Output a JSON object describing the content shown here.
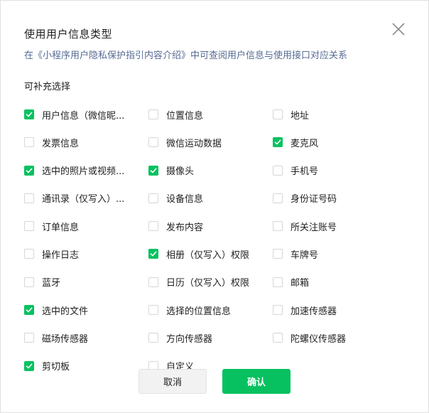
{
  "dialog": {
    "title": "使用用户信息类型",
    "sub_prefix": "在",
    "sub_link": "《小程序用户隐私保护指引内容介绍》",
    "sub_suffix": "中可查阅用户信息与使用接口对应关系",
    "section_label": "可补充选择"
  },
  "options": [
    {
      "label": "用户信息（微信昵...",
      "checked": true
    },
    {
      "label": "位置信息",
      "checked": false
    },
    {
      "label": "地址",
      "checked": false
    },
    {
      "label": "发票信息",
      "checked": false
    },
    {
      "label": "微信运动数据",
      "checked": false
    },
    {
      "label": "麦克风",
      "checked": true
    },
    {
      "label": "选中的照片或视频...",
      "checked": true
    },
    {
      "label": "摄像头",
      "checked": true
    },
    {
      "label": "手机号",
      "checked": false
    },
    {
      "label": "通讯录（仅写入）...",
      "checked": false
    },
    {
      "label": "设备信息",
      "checked": false
    },
    {
      "label": "身份证号码",
      "checked": false
    },
    {
      "label": "订单信息",
      "checked": false
    },
    {
      "label": "发布内容",
      "checked": false
    },
    {
      "label": "所关注账号",
      "checked": false
    },
    {
      "label": "操作日志",
      "checked": false
    },
    {
      "label": "相册（仅写入）权限",
      "checked": true
    },
    {
      "label": "车牌号",
      "checked": false
    },
    {
      "label": "蓝牙",
      "checked": false
    },
    {
      "label": "日历（仅写入）权限",
      "checked": false
    },
    {
      "label": "邮箱",
      "checked": false
    },
    {
      "label": "选中的文件",
      "checked": true
    },
    {
      "label": "选择的位置信息",
      "checked": false
    },
    {
      "label": "加速传感器",
      "checked": false
    },
    {
      "label": "磁场传感器",
      "checked": false
    },
    {
      "label": "方向传感器",
      "checked": false
    },
    {
      "label": "陀螺仪传感器",
      "checked": false
    },
    {
      "label": "剪切板",
      "checked": true
    },
    {
      "label": "自定义",
      "checked": false
    }
  ],
  "buttons": {
    "cancel_label": "取消",
    "confirm_label": "确认"
  },
  "colors": {
    "accent": "#07c160",
    "link": "#576b95"
  }
}
